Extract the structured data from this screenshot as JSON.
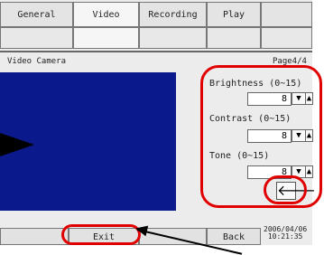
{
  "tabs": [
    "General",
    "Video",
    "Recording",
    "Play"
  ],
  "active_tab_index": 1,
  "section_title": "Video Camera",
  "page_indicator": "Page4/4",
  "controls": [
    {
      "label": "Brightness (0~15)",
      "value": "8"
    },
    {
      "label": "Contrast (0~15)",
      "value": "8"
    },
    {
      "label": "Tone (0~15)",
      "value": "8"
    }
  ],
  "spin_down_glyph": "▼",
  "spin_up_glyph": "▲",
  "back_arrow_glyph": "🡐",
  "buttons": {
    "exit": "Exit",
    "back": "Back"
  },
  "datetime": {
    "date": "2006/04/06",
    "time": "10:21:35"
  },
  "colors": {
    "preview": "#0a1a8c",
    "highlight": "#e10000"
  }
}
